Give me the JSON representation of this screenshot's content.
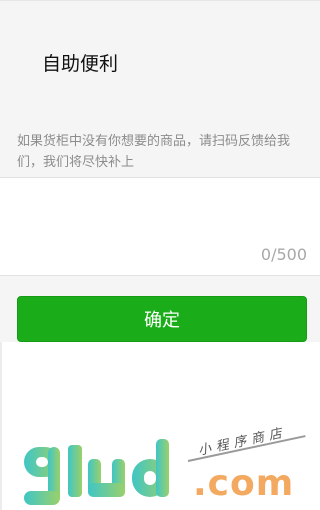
{
  "header": {
    "title": "自助便利",
    "description": "如果货柜中没有你想要的商品，请扫码反馈给我们，我们将尽快补上"
  },
  "feedback": {
    "counter": "0/500"
  },
  "actions": {
    "confirm_label": "确定"
  },
  "watermark": {
    "logo_text": "91ud",
    "domain_suffix": ".com",
    "tagline": "小程序商店"
  },
  "colors": {
    "primary_green": "#1aad19",
    "background_gray": "#f5f5f5",
    "logo_gradient_start": "#3fc6c6",
    "logo_gradient_end": "#9ad06a",
    "com_orange": "#f3a95f"
  }
}
